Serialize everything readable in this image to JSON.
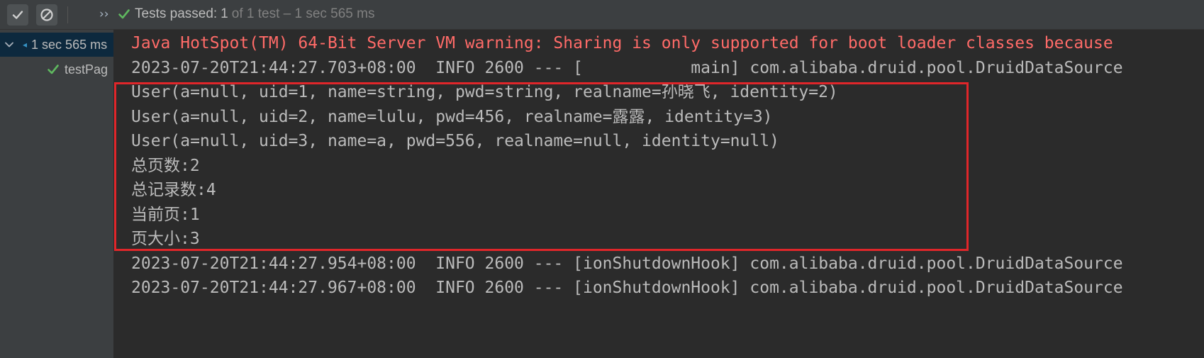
{
  "toolbar": {
    "status_label": "Tests passed:",
    "status_count": "1",
    "status_rest": "of 1 test – 1 sec 565 ms",
    "more_glyph": "››",
    "icons": [
      "checkmark-icon",
      "stop-icon",
      "double-chevron-right-icon"
    ]
  },
  "tree": {
    "root_label": "1 sec 565 ms",
    "child_label": "testPag"
  },
  "console": {
    "lines": [
      "Java HotSpot(TM) 64-Bit Server VM warning: Sharing is only supported for boot loader classes because",
      "2023-07-20T21:44:27.703+08:00  INFO 2600 --- [           main] com.alibaba.druid.pool.DruidDataSource",
      "User(a=null, uid=1, name=string, pwd=string, realname=孙晓飞, identity=2)",
      "User(a=null, uid=2, name=lulu, pwd=456, realname=露露, identity=3)",
      "User(a=null, uid=3, name=a, pwd=556, realname=null, identity=null)",
      "总页数:2",
      "总记录数:4",
      "当前页:1",
      "页大小:3",
      "2023-07-20T21:44:27.954+08:00  INFO 2600 --- [ionShutdownHook] com.alibaba.druid.pool.DruidDataSource",
      "2023-07-20T21:44:27.967+08:00  INFO 2600 --- [ionShutdownHook] com.alibaba.druid.pool.DruidDataSource"
    ]
  },
  "colors": {
    "pass_green": "#5fb85f",
    "warning_red": "#ff6b68",
    "highlight_red": "#e0262a",
    "selection_blue": "#0d293e"
  }
}
